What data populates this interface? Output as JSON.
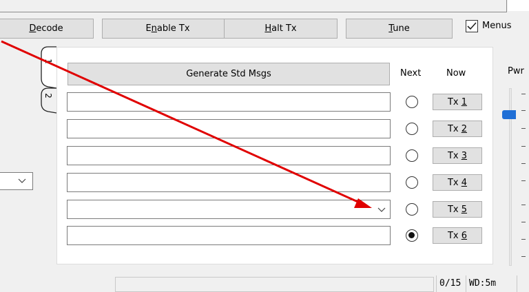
{
  "toolbar": {
    "decode_label": "Decode",
    "enable_tx_label": "Enable Tx",
    "halt_tx_label": "Halt Tx",
    "tune_label": "Tune",
    "menus_label": "Menus",
    "menus_checked": true
  },
  "tabs": {
    "tab1_label": "1",
    "tab2_label": "2"
  },
  "messages": {
    "generate_label": "Generate Std Msgs",
    "next_header": "Next",
    "now_header": "Now",
    "rows": [
      {
        "value": "",
        "tx_label": "Tx 1",
        "selected": false
      },
      {
        "value": "",
        "tx_label": "Tx 2",
        "selected": false
      },
      {
        "value": "",
        "tx_label": "Tx 3",
        "selected": false
      },
      {
        "value": "",
        "tx_label": "Tx 4",
        "selected": false
      },
      {
        "value": "",
        "tx_label": "Tx 5",
        "selected": false,
        "dropdown": true
      },
      {
        "value": "",
        "tx_label": "Tx 6",
        "selected": true
      }
    ]
  },
  "power": {
    "label": "Pwr"
  },
  "status": {
    "count": "0/15",
    "wd": "WD:5m"
  },
  "colors": {
    "annotation_arrow": "#e00000",
    "slider_thumb": "#1f6fd6"
  },
  "icons": {
    "dropdown": "chevron-down-icon",
    "checkbox": "checkmark-icon"
  }
}
